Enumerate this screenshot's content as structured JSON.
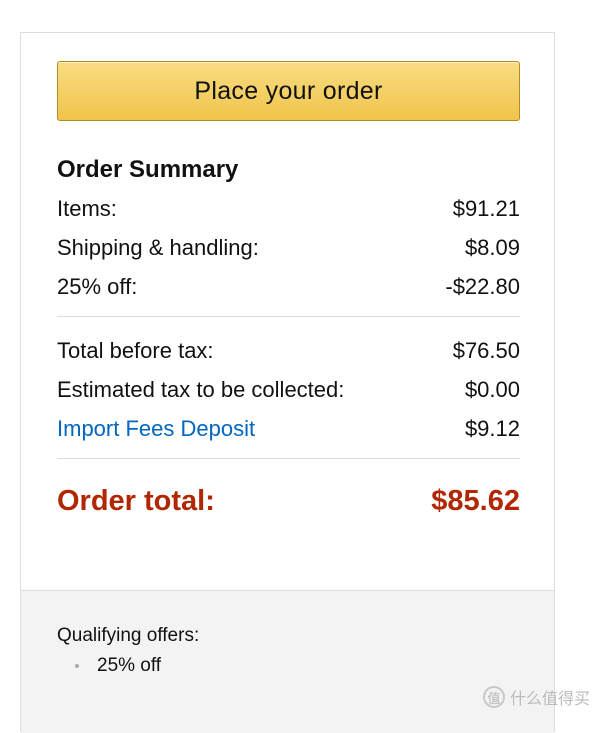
{
  "order_button": {
    "label": "Place your order"
  },
  "summary": {
    "title": "Order Summary",
    "rows_a": [
      {
        "label": "Items:",
        "value": "$91.21"
      },
      {
        "label": "Shipping & handling:",
        "value": "$8.09"
      },
      {
        "label": "25% off:",
        "value": "-$22.80"
      }
    ],
    "rows_b": [
      {
        "label": "Total before tax:",
        "value": "$76.50"
      },
      {
        "label": "Estimated tax to be collected:",
        "value": "$0.00"
      },
      {
        "label": "Import Fees Deposit",
        "value": "$9.12"
      }
    ],
    "total": {
      "label": "Order total:",
      "value": "$85.62"
    }
  },
  "offers": {
    "title": "Qualifying offers:",
    "items": [
      "25% off"
    ]
  },
  "watermark": {
    "text": "什么值得买",
    "icon_glyph": "值"
  },
  "colors": {
    "total_red": "#b12704",
    "link_blue": "#0066c0",
    "button_gold": "#f0c44a"
  }
}
